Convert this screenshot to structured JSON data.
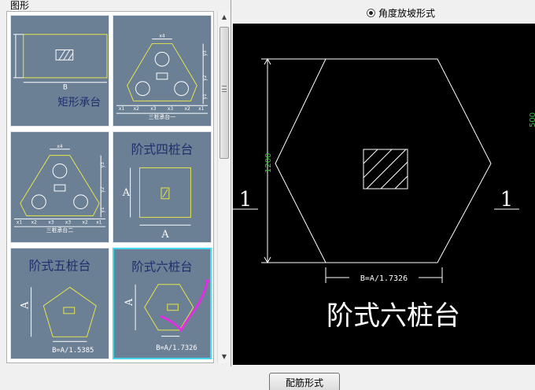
{
  "group_title": "图形",
  "tiles": [
    {
      "label": "矩形承台",
      "dim_b": "B"
    },
    {
      "label": "三桩承台一",
      "dims": [
        "x4",
        "y3",
        "y2",
        "y1",
        "x1",
        "x2",
        "x3",
        "x3",
        "x2",
        "x1"
      ]
    },
    {
      "label": "三桩承台二",
      "dims": [
        "x4",
        "y3",
        "y2",
        "y1",
        "x1",
        "x2",
        "x3",
        "x3",
        "x2",
        "x1"
      ]
    },
    {
      "label": "阶式四桩台",
      "dim_a_side": "A",
      "dim_a_bottom": "A"
    },
    {
      "label": "阶式五桩台",
      "dim_a": "A",
      "formula": "B=A/1.5385"
    },
    {
      "label": "阶式六桩台",
      "dim_a": "A",
      "formula": "B=A/1.7326"
    }
  ],
  "radio": {
    "label": "角度放坡形式",
    "checked": true
  },
  "preview": {
    "title": "阶式六桩台",
    "height_dim": "1200",
    "edge_dim": "500",
    "section_left": "1",
    "section_right": "1",
    "formula": "B=A/1.7326"
  },
  "button": {
    "label": "配筋形式"
  },
  "colors": {
    "tile_bg": "#6b7f95",
    "shape_line": "#e8e84a",
    "title_navy": "#1f2f6e",
    "dim_green": "#30c830",
    "selection": "#46d6ee",
    "check_mark": "#e22ee2"
  }
}
